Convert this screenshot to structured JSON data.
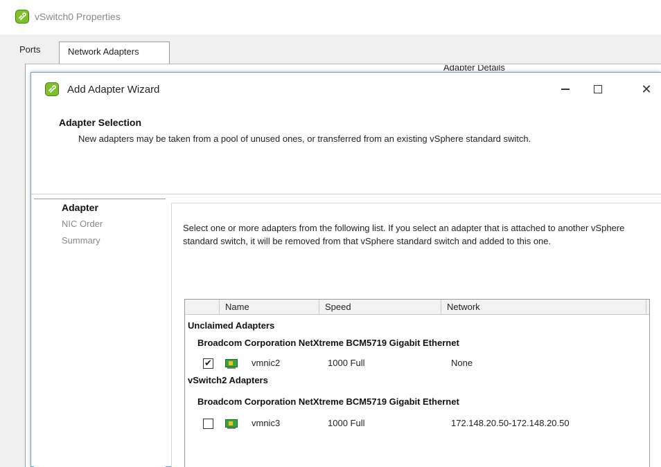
{
  "parent": {
    "title": "vSwitch0 Properties",
    "tabs": [
      "Ports",
      "Network Adapters"
    ],
    "panel_fragment": "Adapter Details"
  },
  "wizard": {
    "title": "Add Adapter Wizard",
    "section_title": "Adapter Selection",
    "section_desc": "New adapters may be taken from a pool of unused ones, or transferred from an existing vSphere standard switch.",
    "steps": [
      "Adapter",
      "NIC Order",
      "Summary"
    ],
    "instructions": "Select one or more adapters from the following list. If you select an adapter that is attached to another vSphere standard switch, it will be removed from that vSphere standard switch and added to this one."
  },
  "table": {
    "columns": [
      "Name",
      "Speed",
      "Network"
    ],
    "groups": [
      {
        "label": "Unclaimed Adapters",
        "device": "Broadcom Corporation NetXtreme BCM5719 Gigabit Ethernet",
        "adapter": {
          "checked": true,
          "checked_glyph": "✔",
          "name": "vmnic2",
          "speed": "1000 Full",
          "network": "None"
        }
      },
      {
        "label": "vSwitch2 Adapters",
        "device": "Broadcom Corporation NetXtreme BCM5719 Gigabit Ethernet",
        "adapter": {
          "checked": false,
          "checked_glyph": "",
          "name": "vmnic3",
          "speed": "1000 Full",
          "network": "172.148.20.50-172.148.20.50"
        }
      }
    ]
  },
  "icons": {
    "app": "vsphere-app-icon",
    "nic": "network-adapter-icon",
    "minimize": "minimize-icon",
    "maximize": "maximize-icon",
    "close": "close-icon"
  },
  "colors": {
    "accent_border": "#6d9ad6",
    "app_icon": "#7fbf2a",
    "nic_icon": "#3aa63a"
  },
  "glyphs": {
    "close": "✕"
  }
}
